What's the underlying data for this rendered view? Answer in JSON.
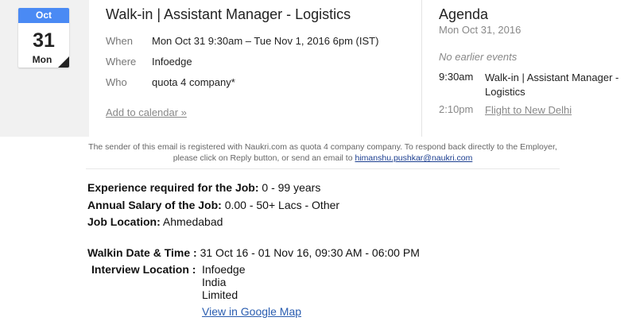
{
  "calendar_tile": {
    "month": "Oct",
    "day": "31",
    "weekday": "Mon"
  },
  "event": {
    "title": "Walk-in | Assistant Manager - Logistics",
    "when_label": "When",
    "when_value": "Mon Oct 31 9:30am – Tue Nov 1, 2016 6pm (IST)",
    "where_label": "Where",
    "where_value": "Infoedge",
    "who_label": "Who",
    "who_value": "quota 4 company*",
    "add_to_calendar": "Add to calendar »"
  },
  "agenda": {
    "title": "Agenda",
    "date": "Mon Oct 31, 2016",
    "no_earlier": "No earlier events",
    "items": [
      {
        "time": "9:30am",
        "name": "Walk-in | Assistant Manager - Logistics"
      },
      {
        "time": "2:10pm",
        "name": "Flight to New Delhi"
      }
    ]
  },
  "notice": {
    "text": "The sender of this email is registered with Naukri.com as quota 4 company company. To respond back directly to the Employer, please click on Reply button, or send an email to",
    "email": "himanshu.pushkar@naukri.com"
  },
  "job": {
    "experience_label": "Experience required for the Job:",
    "experience_value": "0 - 99 years",
    "salary_label": "Annual Salary of the Job:",
    "salary_value": "0.00 - 50+ Lacs - Other",
    "location_label": "Job Location:",
    "location_value": "Ahmedabad",
    "walkin_label": "Walkin Date & Time :",
    "walkin_value": "31 Oct 16 - 01 Nov 16, 09:30 AM - 06:00 PM",
    "interview_label": "Interview Location :",
    "interview_lines": [
      "Infoedge",
      "India",
      "Limited"
    ],
    "map_link": "View in Google Map"
  },
  "colors": {
    "accent": "#4a8af4",
    "link": "#2a5db0",
    "muted": "#888888"
  }
}
